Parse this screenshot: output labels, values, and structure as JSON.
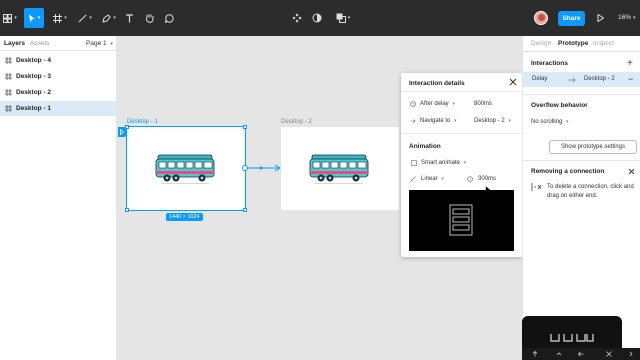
{
  "toolbar": {
    "share_label": "Share",
    "zoom_label": "16%",
    "icons": [
      "figma-menu-icon",
      "move-tool-icon",
      "frame-tool-icon",
      "pen-tool-icon",
      "pen-tool-icon",
      "text-tool-icon",
      "hand-tool-icon",
      "comment-tool-icon",
      "components-icon",
      "mask-icon",
      "boolean-icon",
      "present-icon"
    ]
  },
  "left_panel": {
    "tabs": [
      "Layers",
      "Assets"
    ],
    "page_label": "Page 1",
    "layers": [
      {
        "label": "Desktop - 4",
        "selected": false
      },
      {
        "label": "Desktop - 3",
        "selected": false
      },
      {
        "label": "Desktop - 2",
        "selected": false
      },
      {
        "label": "Desktop - 1",
        "selected": true
      }
    ]
  },
  "canvas": {
    "frame1_label": "Desktop - 1",
    "frame2_label": "Desktop - 2",
    "size_badge": "1440 × 1024",
    "accent": "#0d99ff"
  },
  "dialog": {
    "title": "Interaction details",
    "trigger_label": "After delay",
    "trigger_value": "800ms",
    "action_label": "Navigate to",
    "destination": "Desktop - 2",
    "animation_heading": "Animation",
    "animation_type": "Smart animate",
    "easing": "Linear",
    "duration": "300ms"
  },
  "right_panel": {
    "tabs": [
      "Design",
      "Prototype",
      "Inspect"
    ],
    "interactions_heading": "Interactions",
    "interaction_trigger": "Delay",
    "interaction_target": "Desktop - 2",
    "overflow_heading": "Overflow behavior",
    "overflow_value": "No scrolling",
    "settings_button": "Show prototype settings",
    "removing_heading": "Removing a connection",
    "removing_text": "To delete a connection, click and drag on either end."
  }
}
